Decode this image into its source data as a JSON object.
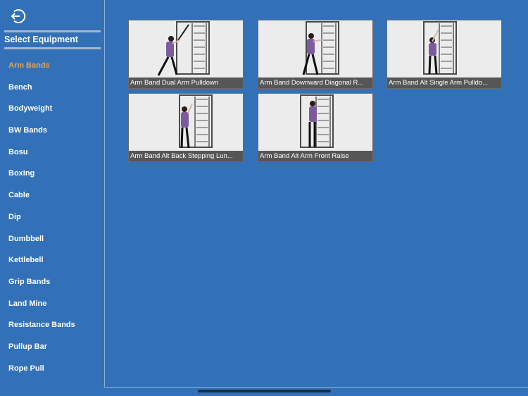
{
  "sidebar": {
    "back_icon": "exit-arrow-circle-icon",
    "title": "Select Equipment",
    "active_index": 0,
    "items": [
      {
        "label": "Arm Bands"
      },
      {
        "label": "Bench"
      },
      {
        "label": "Bodyweight"
      },
      {
        "label": "BW Bands"
      },
      {
        "label": "Bosu"
      },
      {
        "label": "Boxing"
      },
      {
        "label": "Cable"
      },
      {
        "label": "Dip"
      },
      {
        "label": "Dumbbell"
      },
      {
        "label": "Kettlebell"
      },
      {
        "label": "Grip Bands"
      },
      {
        "label": "Land Mine"
      },
      {
        "label": "Resistance Bands"
      },
      {
        "label": "Pullup Bar"
      },
      {
        "label": "Rope Pull"
      }
    ]
  },
  "exercises": [
    {
      "caption": "Arm Band Dual Arm Pulldown"
    },
    {
      "caption": "Arm Band Downward Diagonal R..."
    },
    {
      "caption": "Arm Band Alt Single Arm Pulldo..."
    },
    {
      "caption": "Arm Band Alt Back Stepping Lun..."
    },
    {
      "caption": "Arm Band Alt Arm Front Raise"
    }
  ],
  "colors": {
    "background": "#3271b8",
    "active_item": "#e0a35a",
    "caption_bar": "#565656"
  }
}
